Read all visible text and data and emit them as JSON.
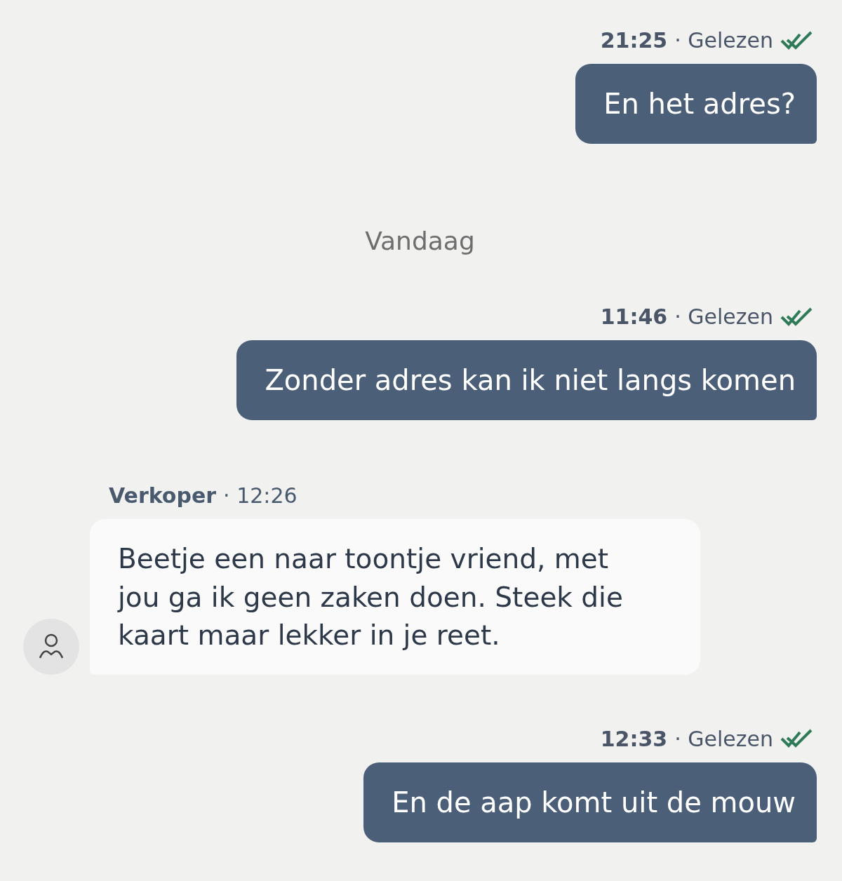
{
  "messages": [
    {
      "kind": "sent",
      "time": "21:25",
      "status": "· Gelezen",
      "read": true,
      "text": "En het adres?"
    },
    {
      "kind": "divider",
      "text": "Vandaag"
    },
    {
      "kind": "sent",
      "time": "11:46",
      "status": "· Gelezen",
      "read": true,
      "text": "Zonder adres kan ik niet langs komen"
    },
    {
      "kind": "received",
      "sender": "Verkoper",
      "time": "· 12:26",
      "text": "Beetje een naar toontje vriend, met jou ga ik geen zaken doen. Steek die kaart maar lekker in je reet."
    },
    {
      "kind": "sent",
      "time": "12:33",
      "status": "· Gelezen",
      "read": true,
      "text": "En de aap komt uit de mouw"
    }
  ]
}
